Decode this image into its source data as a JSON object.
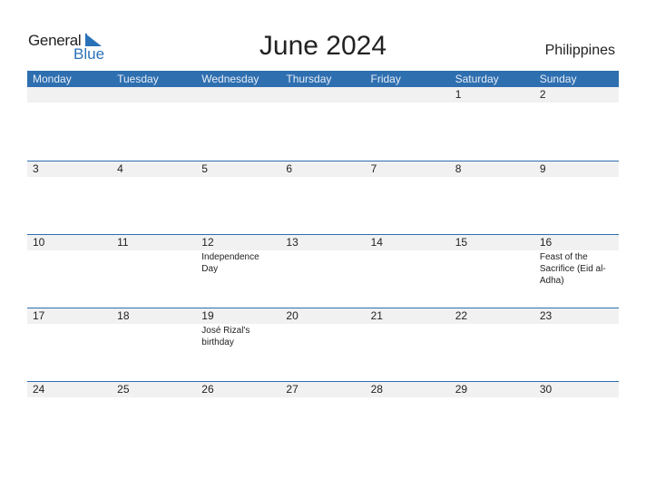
{
  "logo": {
    "line1": "General",
    "line2": "Blue",
    "brand_color": "#2a72b8"
  },
  "title": "June 2024",
  "country": "Philippines",
  "colors": {
    "header_bg": "#2e6fb0",
    "date_band": "#f1f1f1"
  },
  "weekdays": [
    "Monday",
    "Tuesday",
    "Wednesday",
    "Thursday",
    "Friday",
    "Saturday",
    "Sunday"
  ],
  "weeks": [
    {
      "days": [
        {
          "date": "",
          "event": ""
        },
        {
          "date": "",
          "event": ""
        },
        {
          "date": "",
          "event": ""
        },
        {
          "date": "",
          "event": ""
        },
        {
          "date": "",
          "event": ""
        },
        {
          "date": "1",
          "event": ""
        },
        {
          "date": "2",
          "event": ""
        }
      ]
    },
    {
      "days": [
        {
          "date": "3",
          "event": ""
        },
        {
          "date": "4",
          "event": ""
        },
        {
          "date": "5",
          "event": ""
        },
        {
          "date": "6",
          "event": ""
        },
        {
          "date": "7",
          "event": ""
        },
        {
          "date": "8",
          "event": ""
        },
        {
          "date": "9",
          "event": ""
        }
      ]
    },
    {
      "days": [
        {
          "date": "10",
          "event": ""
        },
        {
          "date": "11",
          "event": ""
        },
        {
          "date": "12",
          "event": "Independence Day"
        },
        {
          "date": "13",
          "event": ""
        },
        {
          "date": "14",
          "event": ""
        },
        {
          "date": "15",
          "event": ""
        },
        {
          "date": "16",
          "event": "Feast of the Sacrifice (Eid al-Adha)"
        }
      ]
    },
    {
      "days": [
        {
          "date": "17",
          "event": ""
        },
        {
          "date": "18",
          "event": ""
        },
        {
          "date": "19",
          "event": "José Rizal's birthday"
        },
        {
          "date": "20",
          "event": ""
        },
        {
          "date": "21",
          "event": ""
        },
        {
          "date": "22",
          "event": ""
        },
        {
          "date": "23",
          "event": ""
        }
      ]
    },
    {
      "days": [
        {
          "date": "24",
          "event": ""
        },
        {
          "date": "25",
          "event": ""
        },
        {
          "date": "26",
          "event": ""
        },
        {
          "date": "27",
          "event": ""
        },
        {
          "date": "28",
          "event": ""
        },
        {
          "date": "29",
          "event": ""
        },
        {
          "date": "30",
          "event": ""
        }
      ]
    }
  ]
}
